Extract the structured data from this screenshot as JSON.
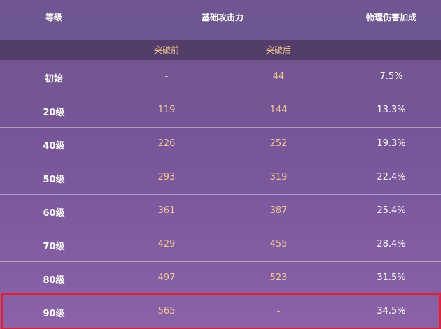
{
  "header": {
    "level": "等级",
    "base_atk": "基础攻击力",
    "phys_bonus": "物理伤害加成"
  },
  "subheader": {
    "before": "突破前",
    "after": "突破后"
  },
  "rows": [
    {
      "level": "初始",
      "before": "-",
      "after": "44",
      "phys": "7.5%"
    },
    {
      "level": "20级",
      "before": "119",
      "after": "144",
      "phys": "13.3%"
    },
    {
      "level": "40级",
      "before": "226",
      "after": "252",
      "phys": "19.3%"
    },
    {
      "level": "50级",
      "before": "293",
      "after": "319",
      "phys": "22.4%"
    },
    {
      "level": "60级",
      "before": "361",
      "after": "387",
      "phys": "25.4%"
    },
    {
      "level": "70级",
      "before": "429",
      "after": "455",
      "phys": "28.4%"
    },
    {
      "level": "80级",
      "before": "497",
      "after": "523",
      "phys": "31.5%"
    },
    {
      "level": "90级",
      "before": "565",
      "after": "-",
      "phys": "34.5%"
    }
  ],
  "highlight_row": "90级",
  "colors": {
    "header_bg": "#6f5590",
    "subheader_bg": "#533e69",
    "value_text": "#f0c98f",
    "highlight_border": "#e81e2a"
  }
}
